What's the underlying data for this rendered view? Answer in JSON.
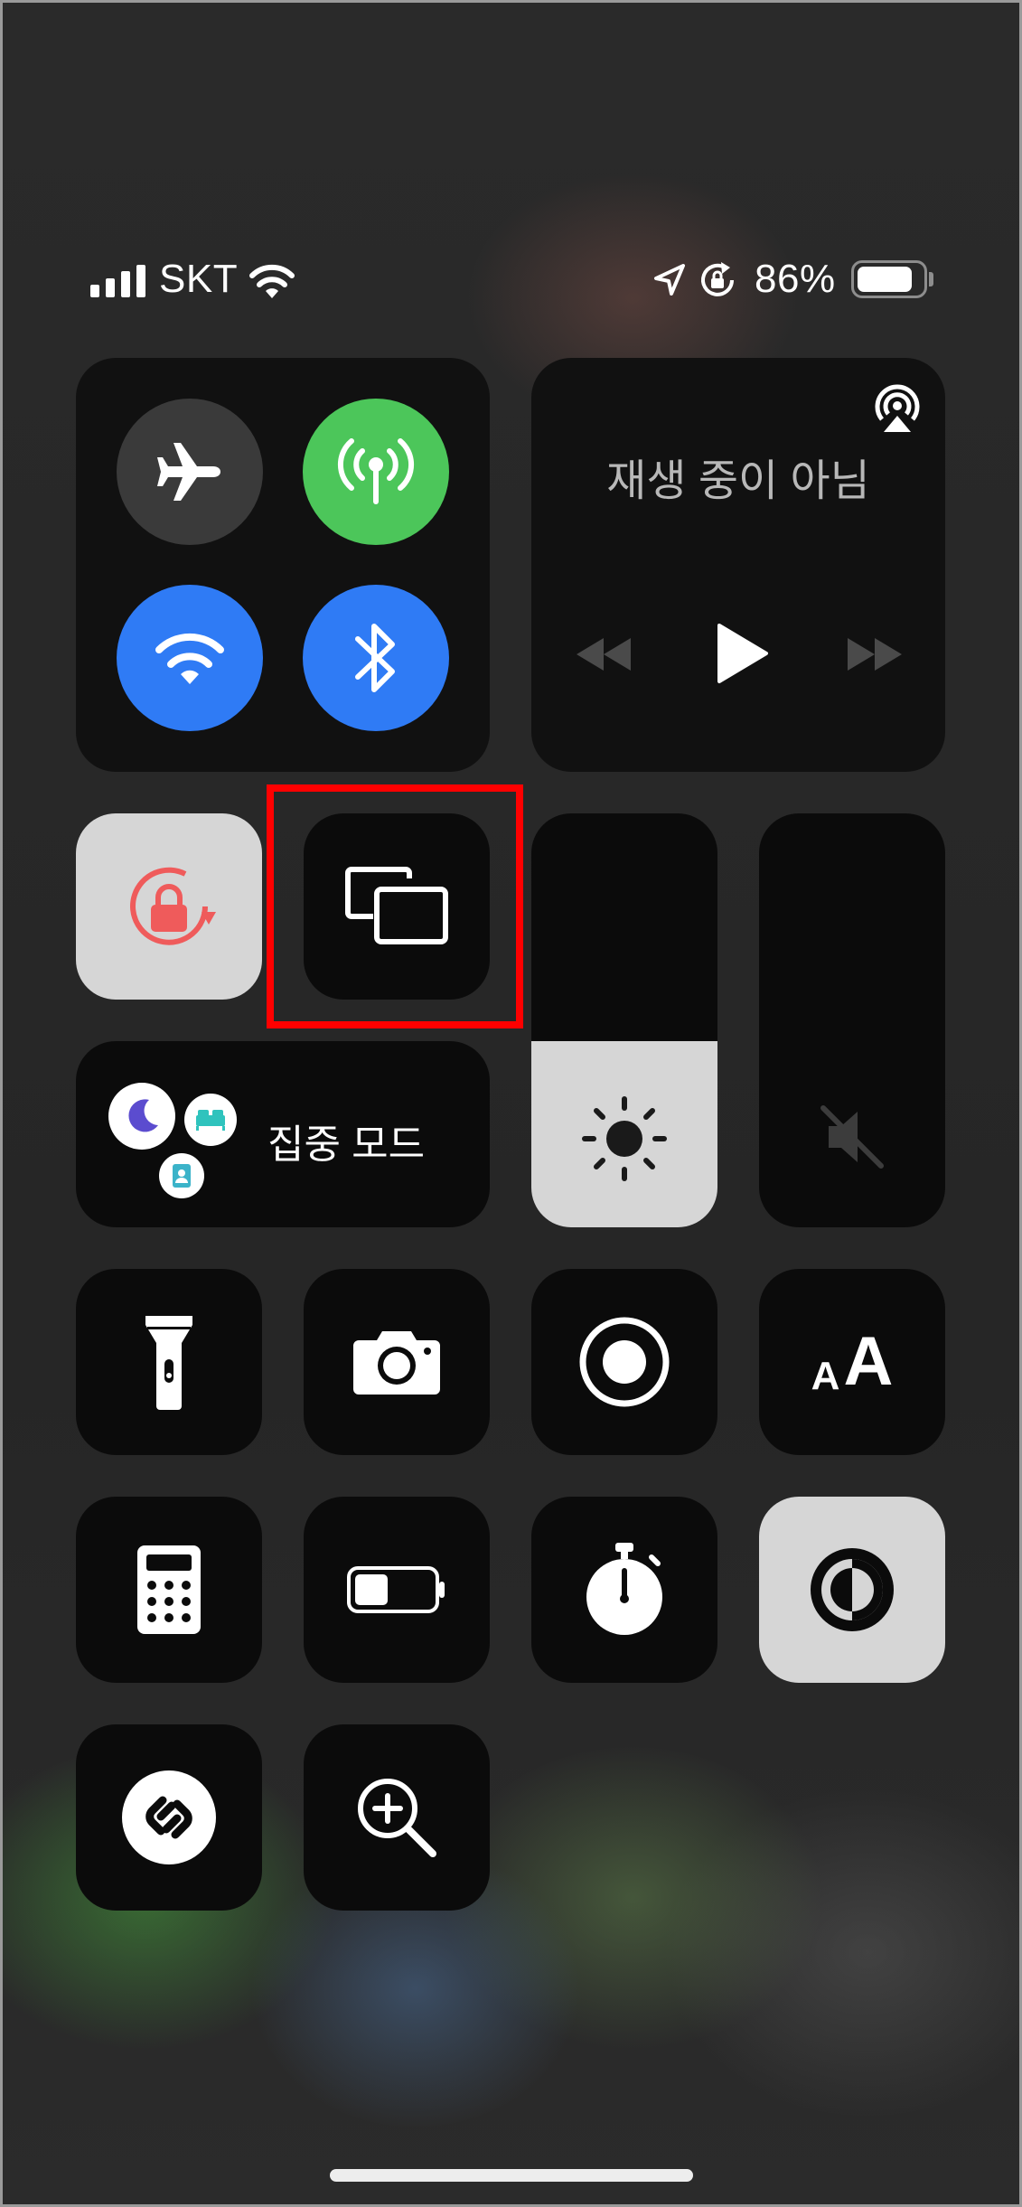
{
  "status_bar": {
    "carrier": "SKT",
    "battery_percent": "86%",
    "battery_level": 0.86,
    "icons": [
      "signal-icon",
      "wifi-icon",
      "location-icon",
      "orientation-lock-icon",
      "battery-icon"
    ]
  },
  "connectivity": {
    "airplane_mode": {
      "icon": "airplane-icon",
      "state": "off"
    },
    "cellular_data": {
      "icon": "antenna-icon",
      "state": "on",
      "color": "#4cc65a"
    },
    "wifi": {
      "icon": "wifi-icon",
      "state": "on",
      "color": "#2f7bf5"
    },
    "bluetooth": {
      "icon": "bluetooth-icon",
      "state": "on",
      "color": "#2f7bf5"
    }
  },
  "now_playing": {
    "title": "재생 중이 아님",
    "airplay_icon": "airplay-icon",
    "controls": [
      "rewind-icon",
      "play-icon",
      "fast-forward-icon"
    ]
  },
  "focus": {
    "label": "집중 모드",
    "icons": [
      "moon-icon",
      "bed-icon",
      "person-badge-icon"
    ]
  },
  "sliders": {
    "brightness": {
      "icon": "sun-icon",
      "level": 0.45
    },
    "volume": {
      "icon": "speaker-muted-icon",
      "level": 0.0
    }
  },
  "controls": [
    {
      "name": "orientation-lock-button",
      "icon": "orientation-lock-icon",
      "state": "on"
    },
    {
      "name": "screen-mirroring-button",
      "icon": "screen-mirroring-icon",
      "highlighted": true
    },
    {
      "name": "flashlight-button",
      "icon": "flashlight-icon"
    },
    {
      "name": "camera-button",
      "icon": "camera-icon"
    },
    {
      "name": "screen-recording-button",
      "icon": "record-icon"
    },
    {
      "name": "text-size-button",
      "icon": "text-size-icon",
      "small_letter": "A",
      "large_letter": "A"
    },
    {
      "name": "calculator-button",
      "icon": "calculator-icon"
    },
    {
      "name": "low-power-mode-button",
      "icon": "battery-icon"
    },
    {
      "name": "timer-button",
      "icon": "stopwatch-icon"
    },
    {
      "name": "dark-mode-button",
      "icon": "dark-mode-icon",
      "state": "on"
    },
    {
      "name": "shazam-button",
      "icon": "shazam-icon"
    },
    {
      "name": "magnifier-button",
      "icon": "magnifier-icon"
    }
  ],
  "colors": {
    "accent_red": "#ff0000",
    "green": "#4cc65a",
    "blue": "#2f7bf5",
    "orientation_lock_red": "#ef5b5b"
  }
}
